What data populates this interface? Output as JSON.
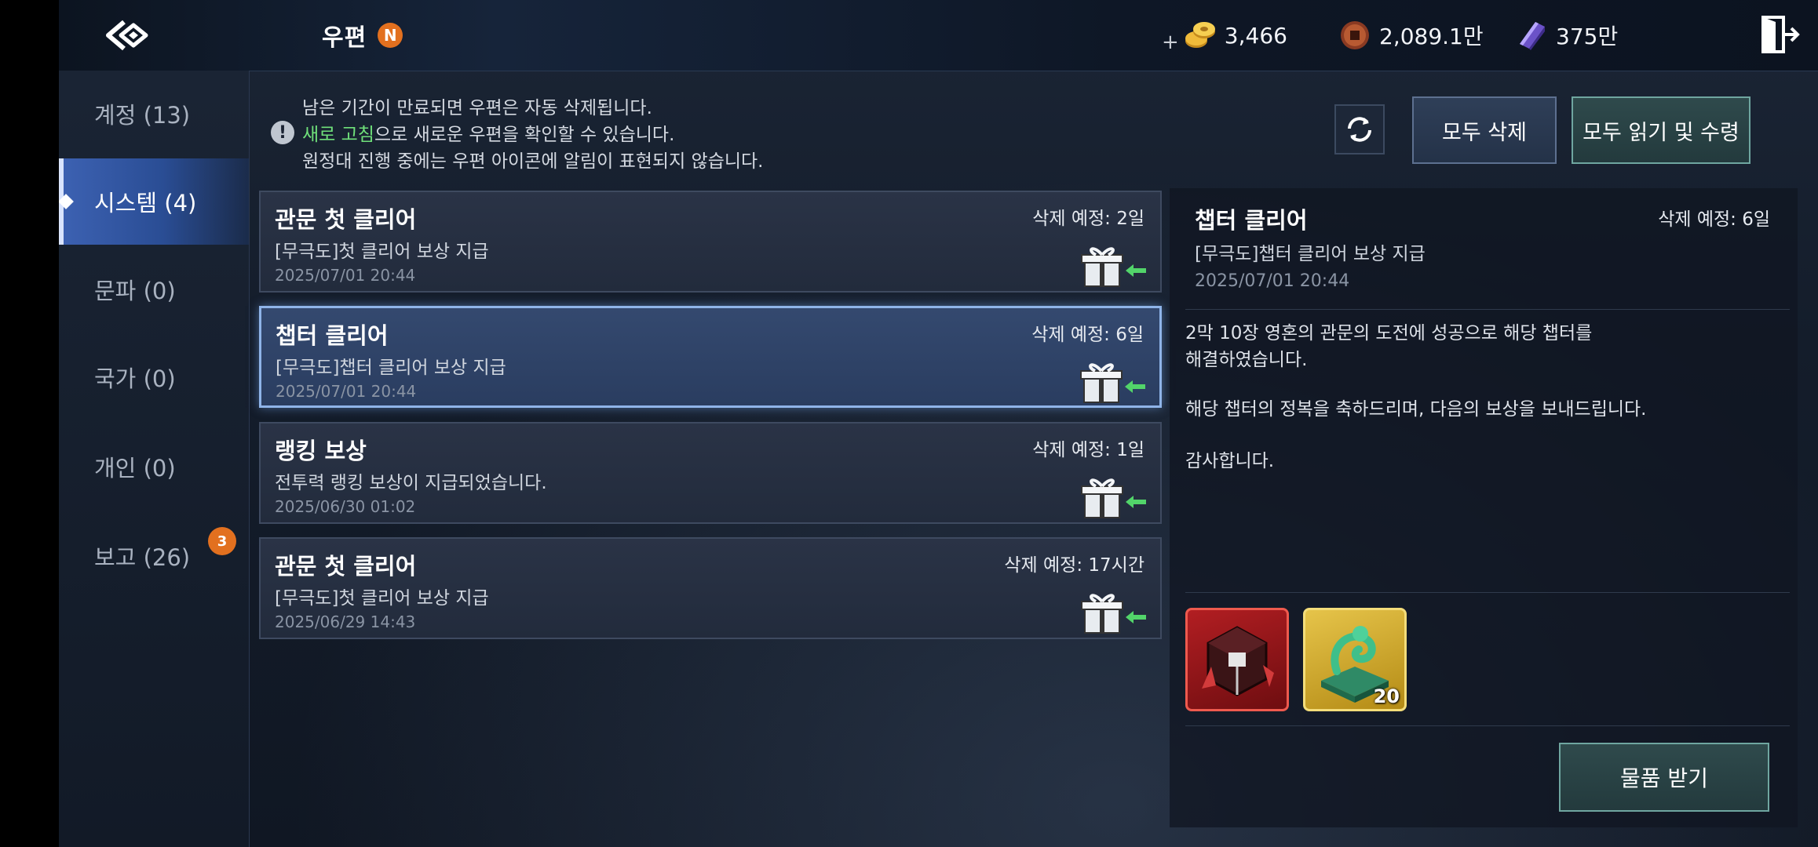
{
  "header": {
    "title": "우편",
    "new_badge": "N",
    "currencies": [
      {
        "icon": "gold-coins-icon",
        "value": "3,466",
        "plus": "+"
      },
      {
        "icon": "bronze-coin-icon",
        "value": "2,089.1만"
      },
      {
        "icon": "purple-crystal-icon",
        "value": "375만"
      }
    ]
  },
  "sidebar": {
    "items": [
      {
        "label": "계정 (13)"
      },
      {
        "label": "시스템 (4)",
        "active": true
      },
      {
        "label": "문파 (0)"
      },
      {
        "label": "국가 (0)"
      },
      {
        "label": "개인 (0)"
      },
      {
        "label": "보고 (26)",
        "badge": "3"
      }
    ]
  },
  "notice": {
    "line1": "남은 기간이 만료되면 우편은 자동 삭제됩니다.",
    "line2_highlight": "새로 고침",
    "line2_rest": "으로 새로운 우편을 확인할 수 있습니다.",
    "line3": "원정대 진행 중에는 우편 아이콘에 알림이 표현되지 않습니다."
  },
  "toolbar": {
    "delete_all": "모두 삭제",
    "read_all": "모두 읽기 및 수령"
  },
  "mails": [
    {
      "title": "관문 첫 클리어",
      "expire": "삭제 예정: 2일",
      "sub": "[무극도]첫 클리어 보상 지급",
      "date": "2025/07/01 20:44"
    },
    {
      "title": "챕터 클리어",
      "expire": "삭제 예정: 6일",
      "sub": "[무극도]챕터 클리어 보상 지급",
      "date": "2025/07/01 20:44",
      "selected": true
    },
    {
      "title": "랭킹 보상",
      "expire": "삭제 예정: 1일",
      "sub": "전투력 랭킹 보상이 지급되었습니다.",
      "date": "2025/06/30 01:02"
    },
    {
      "title": "관문 첫 클리어",
      "expire": "삭제 예정: 17시간",
      "sub": "[무극도]첫 클리어 보상 지급",
      "date": "2025/06/29 14:43"
    }
  ],
  "detail": {
    "title": "챕터 클리어",
    "expire": "삭제 예정: 6일",
    "sub": "[무극도]챕터 클리어 보상 지급",
    "date": "2025/07/01 20:44",
    "body": [
      "2막 10장 영혼의 관문의 도전에 성공으로 해당 챕터를",
      "해결하였습니다.",
      "",
      "해당 챕터의 정복을 축하드리며, 다음의 보상을 보내드립니다.",
      "",
      "감사합니다."
    ],
    "rewards": [
      {
        "icon": "red-crystal-box-icon",
        "quantity": ""
      },
      {
        "icon": "jade-dragon-seal-icon",
        "quantity": "20"
      }
    ],
    "receive_button": "물품 받기"
  }
}
